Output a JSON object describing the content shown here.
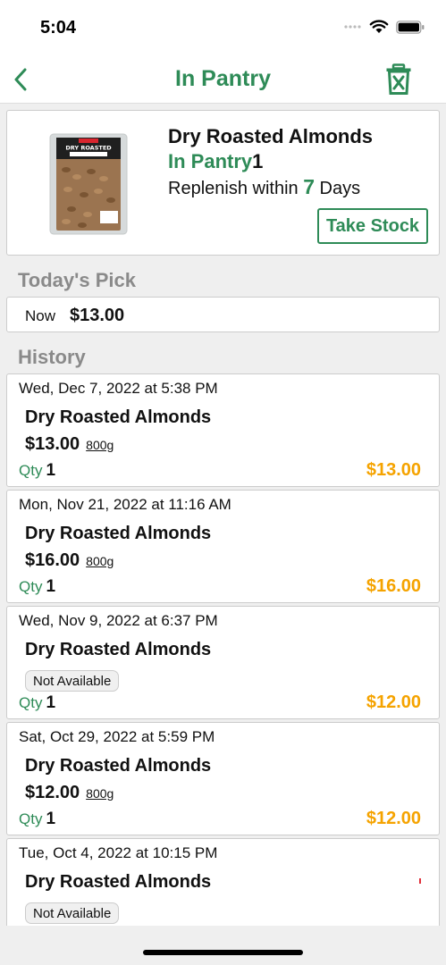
{
  "status_bar": {
    "time": "5:04",
    "icons": [
      "signal-icon",
      "wifi-icon",
      "battery-icon"
    ]
  },
  "nav": {
    "title": "In Pantry",
    "back_icon": "chevron-left-icon",
    "trash_icon": "trash-icon"
  },
  "product": {
    "name": "Dry Roasted Almonds",
    "pantry_label": "In Pantry",
    "pantry_count": "1",
    "replenish_prefix": "Replenish within ",
    "replenish_days": "7",
    "replenish_suffix": " Days",
    "take_stock_label": "Take Stock",
    "image_text": "DRY ROASTED"
  },
  "todays_pick": {
    "heading": "Today's Pick",
    "label": "Now",
    "price": "$13.00"
  },
  "history": {
    "heading": "History",
    "entries": [
      {
        "date": "Wed, Dec 7, 2022 at 5:38 PM",
        "name": "Dry Roasted Almonds",
        "price": "$13.00",
        "size": "800g",
        "badge": "",
        "qty_label": "Qty",
        "qty": "1",
        "total": "$13.00"
      },
      {
        "date": "Mon, Nov 21, 2022 at 11:16 AM",
        "name": "Dry Roasted Almonds",
        "price": "$16.00",
        "size": "800g",
        "badge": "",
        "qty_label": "Qty",
        "qty": "1",
        "total": "$16.00"
      },
      {
        "date": "Wed, Nov 9, 2022 at 6:37 PM",
        "name": "Dry Roasted Almonds",
        "price": "",
        "size": "",
        "badge": "Not Available",
        "qty_label": "Qty",
        "qty": "1",
        "total": "$12.00"
      },
      {
        "date": "Sat, Oct 29, 2022 at 5:59 PM",
        "name": "Dry Roasted Almonds",
        "price": "$12.00",
        "size": "800g",
        "badge": "",
        "qty_label": "Qty",
        "qty": "1",
        "total": "$12.00"
      },
      {
        "date": "Tue, Oct 4, 2022 at 10:15 PM",
        "name": "Dry Roasted Almonds",
        "price": "",
        "size": "",
        "badge": "Not Available",
        "qty_label": "",
        "qty": "",
        "total": ""
      }
    ]
  },
  "colors": {
    "accent_green": "#2e8b57",
    "price_orange": "#f5a300",
    "section_gray": "#8a8a8a"
  }
}
